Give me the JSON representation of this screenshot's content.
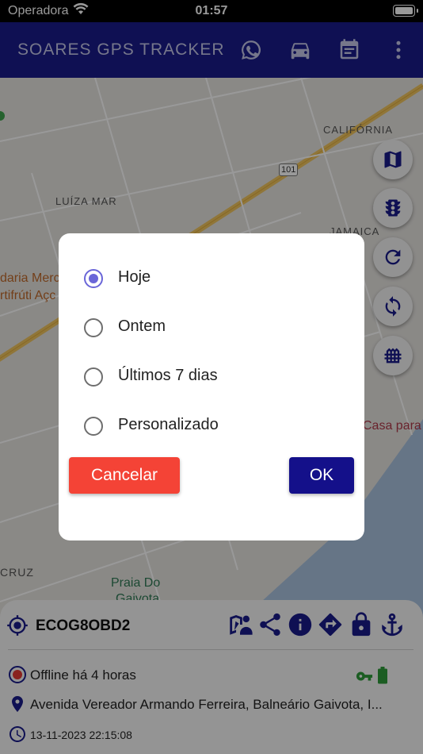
{
  "status_bar": {
    "carrier": "Operadora",
    "time": "01:57"
  },
  "app_bar": {
    "title": "SOARES GPS TRACKER",
    "icons": [
      "whatsapp-icon",
      "car-icon",
      "calendar-icon",
      "more-vert-icon"
    ],
    "background": "#1a1c8a"
  },
  "map": {
    "labels": [
      "CALIFÓRNIA",
      "LUÍZA MAR",
      "JAMAICA",
      "Casa para",
      "CRUZ",
      "Praia Do",
      "Gaivota",
      "daria Merc",
      "rtifrúti Açc",
      "101"
    ],
    "fab_icons": [
      "map-icon",
      "traffic-light-icon",
      "refresh-icon",
      "sync-icon",
      "fence-icon"
    ]
  },
  "dialog": {
    "options": [
      {
        "label": "Hoje",
        "selected": true
      },
      {
        "label": "Ontem",
        "selected": false
      },
      {
        "label": "Últimos 7 dias",
        "selected": false
      },
      {
        "label": "Personalizado",
        "selected": false
      }
    ],
    "cancel_label": "Cancelar",
    "ok_label": "OK",
    "accent": "#6a66d8",
    "cancel_color": "#f44336",
    "ok_color": "#14108a"
  },
  "device_panel": {
    "device_name": "ECOG8OBD2",
    "actions": [
      "map-person-icon",
      "share-icon",
      "info-icon",
      "directions-icon",
      "lock-icon",
      "anchor-icon"
    ],
    "status": "Offline há 4 horas",
    "address": "Avenida Vereador Armando Ferreira, Balneário Gaivota, I...",
    "timestamp": "13-11-2023 22:15:08",
    "status_color": "#e53935",
    "ignition_color": "#2e9c3a"
  }
}
